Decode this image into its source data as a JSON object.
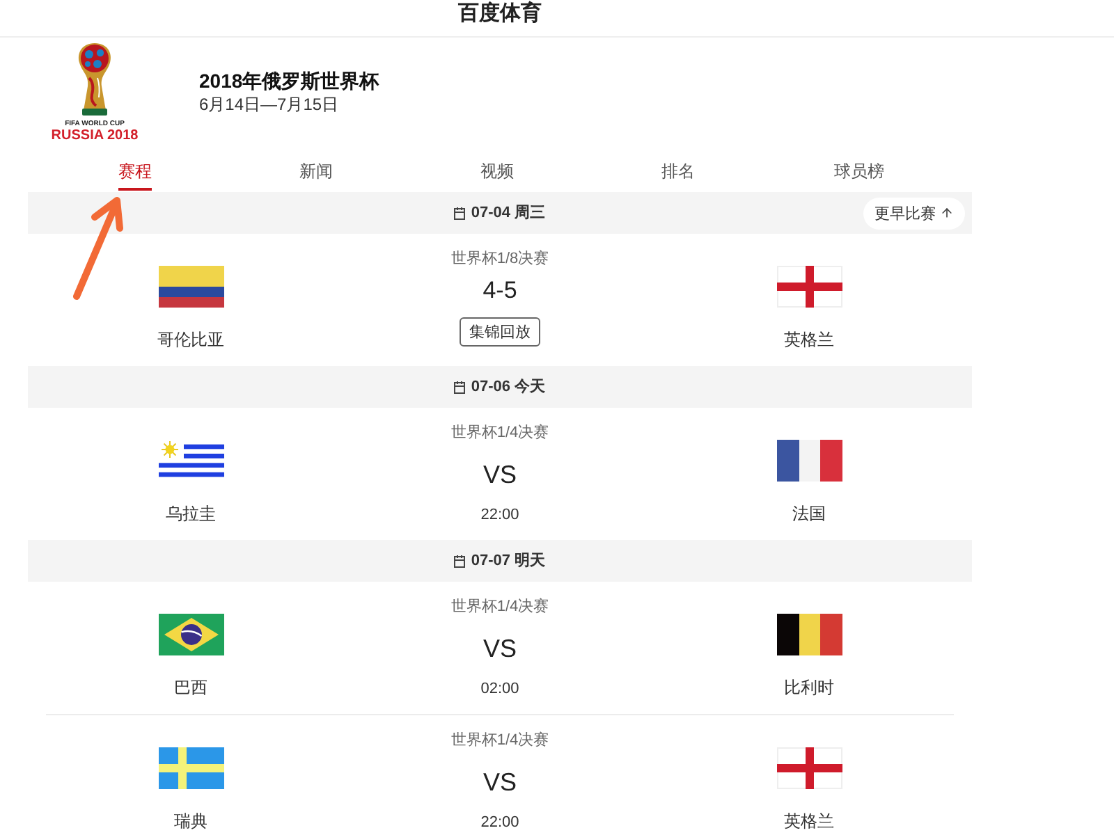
{
  "site_title": "百度体育",
  "event": {
    "logo": {
      "caption": "FIFA WORLD CUP",
      "wordmark": "RUSSIA 2018"
    },
    "title": "2018年俄罗斯世界杯",
    "dates": "6月14日—7月15日"
  },
  "tabs": [
    {
      "label": "赛程",
      "selected": true
    },
    {
      "label": "新闻",
      "selected": false
    },
    {
      "label": "视频",
      "selected": false
    },
    {
      "label": "排名",
      "selected": false
    },
    {
      "label": "球员榜",
      "selected": false
    }
  ],
  "days": [
    {
      "date": "07-04 周三",
      "earlier_button": {
        "label": "更早比赛"
      },
      "matches": [
        {
          "kind": "finished",
          "stage": "世界杯1/8决赛",
          "home": {
            "name": "哥伦比亚",
            "kind": "colombia"
          },
          "away": {
            "name": "英格兰",
            "kind": "england"
          },
          "score": "4-5",
          "replay_button": "集锦回放"
        }
      ]
    },
    {
      "date": "07-06 今天",
      "matches": [
        {
          "kind": "upcoming",
          "stage": "世界杯1/4决赛",
          "home": {
            "name": "乌拉圭",
            "kind": "uruguay"
          },
          "away": {
            "name": "法国",
            "kind": "france"
          },
          "versus": "VS",
          "time": "22:00"
        }
      ]
    },
    {
      "date": "07-07 明天",
      "matches": [
        {
          "kind": "upcoming",
          "stage": "世界杯1/4决赛",
          "home": {
            "name": "巴西",
            "kind": "brazil"
          },
          "away": {
            "name": "比利时",
            "kind": "belgium"
          },
          "versus": "VS",
          "time": "02:00"
        },
        {
          "kind": "upcoming",
          "stage": "世界杯1/4决赛",
          "home": {
            "name": "瑞典",
            "kind": "sweden"
          },
          "away": {
            "name": "英格兰",
            "kind": "england"
          },
          "versus": "VS",
          "time": "22:00"
        }
      ]
    }
  ]
}
